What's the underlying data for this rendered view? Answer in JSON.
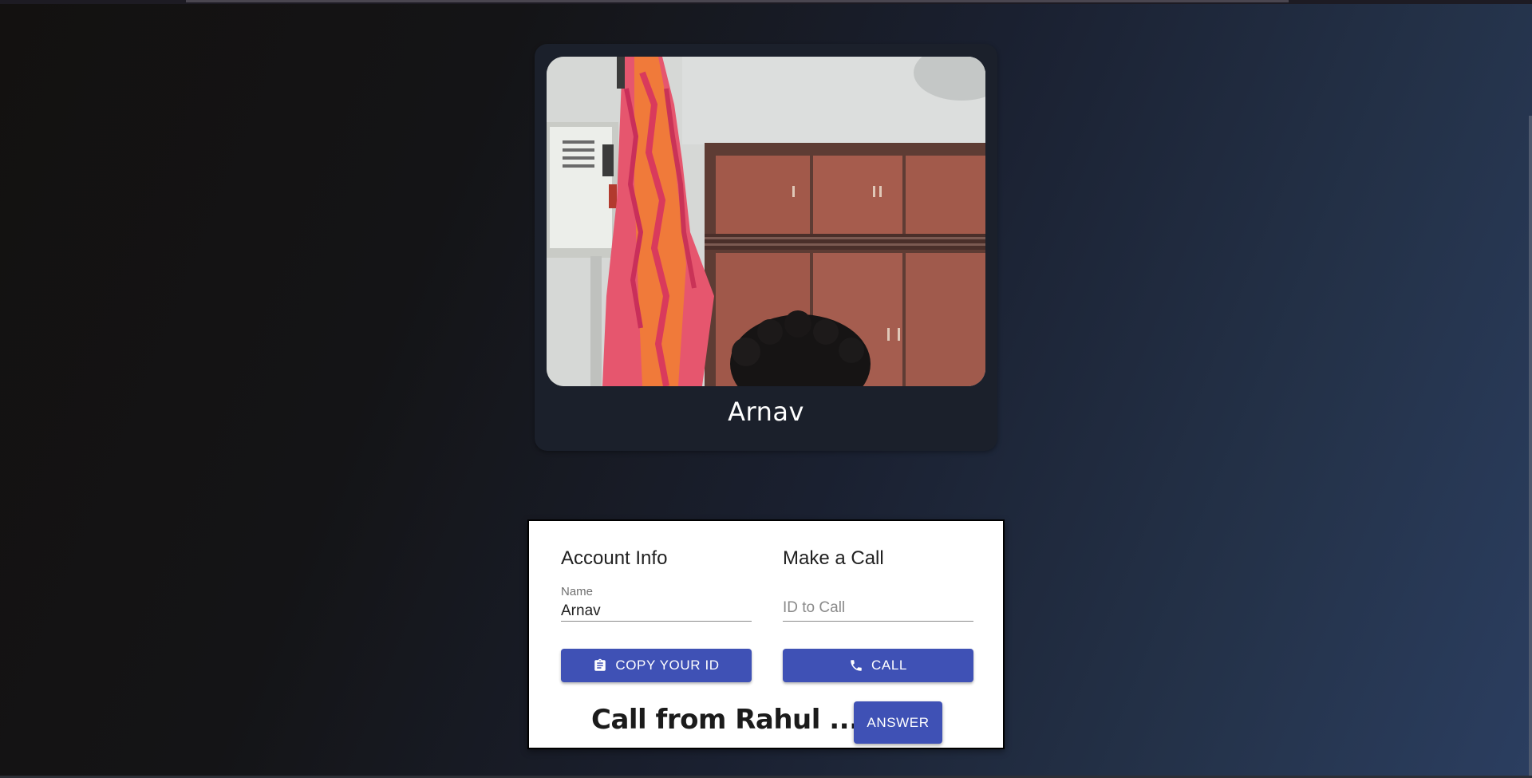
{
  "video": {
    "name": "Arnav"
  },
  "account": {
    "heading": "Account Info",
    "name_label": "Name",
    "name_value": "Arnav",
    "copy_button_label": "Copy Your ID",
    "copy_icon": "clipboard-icon"
  },
  "call": {
    "heading": "Make a Call",
    "id_placeholder": "ID to Call",
    "id_value": "",
    "call_button_label": "Call",
    "call_icon": "phone-icon"
  },
  "incoming_call": {
    "text": "Call from Rahul ...",
    "answer_label": "Answer"
  },
  "colors": {
    "primary_button": "#3f51b5",
    "card_background": "#1b202b",
    "panel_background": "#ffffff"
  }
}
